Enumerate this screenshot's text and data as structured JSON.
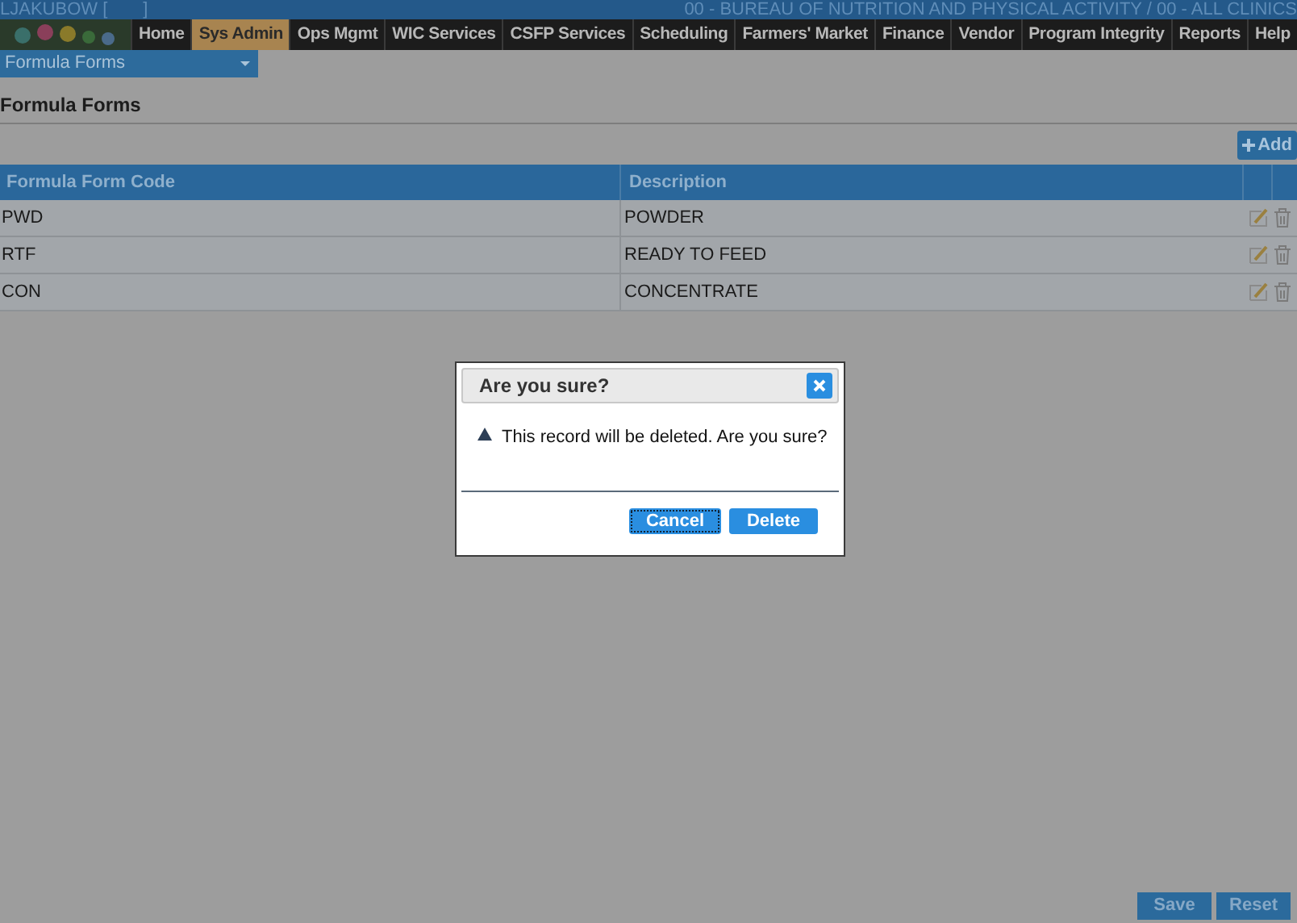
{
  "header": {
    "user": "LJAKUBOW [",
    "user_end": "]",
    "agency": "00 - BUREAU OF NUTRITION AND PHYSICAL ACTIVITY / 00 - ALL CLINICS"
  },
  "nav": [
    {
      "label": "Home",
      "selected": false
    },
    {
      "label": "Sys Admin",
      "selected": true
    },
    {
      "label": "Ops Mgmt",
      "selected": false
    },
    {
      "label": "WIC Services",
      "selected": false
    },
    {
      "label": "CSFP Services",
      "selected": false
    },
    {
      "label": "Scheduling",
      "selected": false
    },
    {
      "label": "Farmers' Market",
      "selected": false
    },
    {
      "label": "Finance",
      "selected": false
    },
    {
      "label": "Vendor",
      "selected": false
    },
    {
      "label": "Program Integrity",
      "selected": false
    },
    {
      "label": "Reports",
      "selected": false
    },
    {
      "label": "Help",
      "selected": false
    }
  ],
  "submenu": {
    "value": "Formula Forms"
  },
  "page_title": "Formula Forms",
  "add_button": "Add",
  "table": {
    "columns": [
      "Formula Form Code",
      "Description"
    ],
    "rows": [
      [
        "PWD",
        "POWDER"
      ],
      [
        "RTF",
        "READY TO FEED"
      ],
      [
        "CON",
        "CONCENTRATE"
      ]
    ]
  },
  "dialog": {
    "title": "Are you sure?",
    "message": "This record will be deleted. Are you sure?",
    "buttons": [
      "Cancel",
      "Delete"
    ]
  },
  "footer_buttons": [
    "Save",
    "Reset"
  ]
}
